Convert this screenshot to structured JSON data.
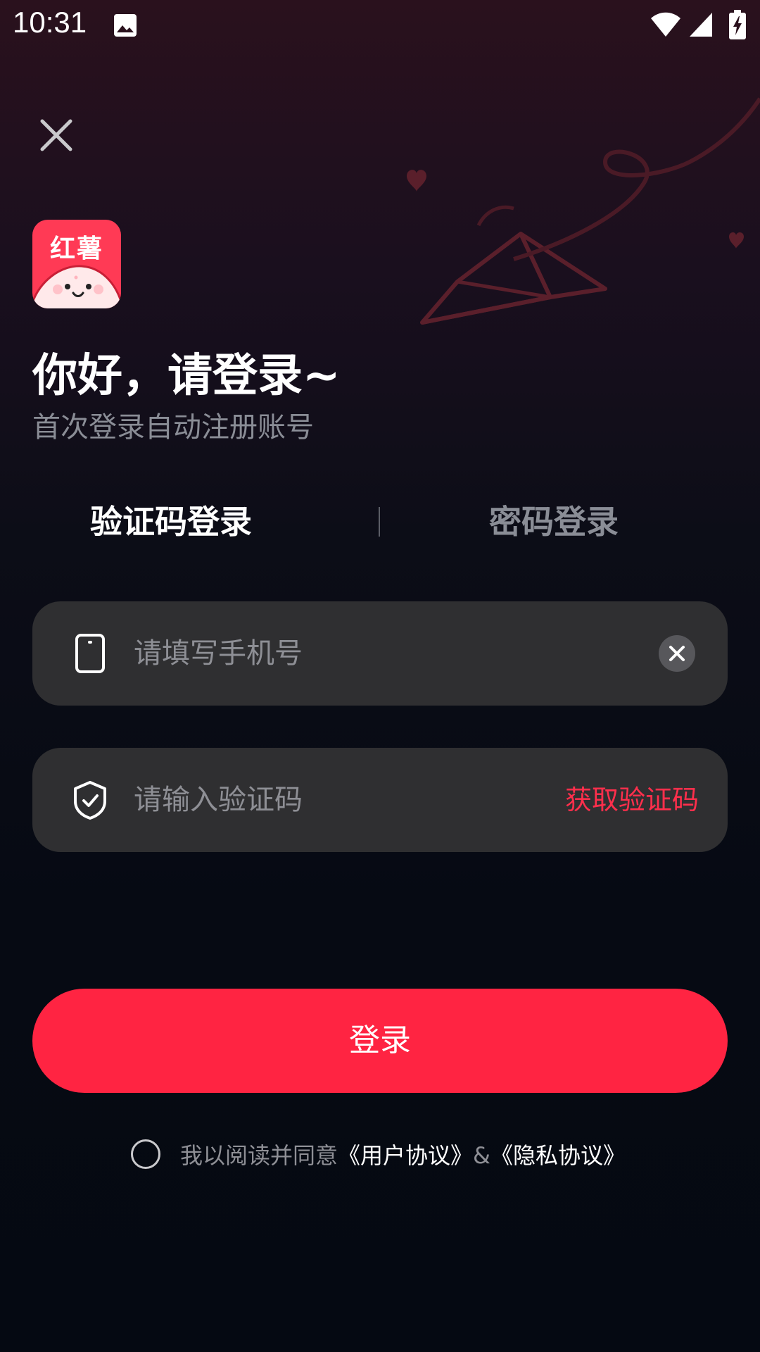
{
  "status_bar": {
    "time": "10:31"
  },
  "icons": {
    "status_image": "image-icon",
    "wifi": "wifi-icon",
    "signal": "signal-icon",
    "battery": "battery-charging-icon",
    "close": "close-icon",
    "phone": "phone-icon",
    "shield": "shield-check-icon",
    "clear": "clear-icon"
  },
  "logo": {
    "text": "红薯"
  },
  "header": {
    "greeting": "你好，请登录~",
    "subtitle": "首次登录自动注册账号"
  },
  "tabs": {
    "code_login": "验证码登录",
    "password_login": "密码登录"
  },
  "phone_field": {
    "placeholder": "请填写手机号",
    "value": ""
  },
  "code_field": {
    "placeholder": "请输入验证码",
    "value": "",
    "get_code_label": "获取验证码"
  },
  "login_button": {
    "label": "登录"
  },
  "agreement": {
    "prefix": "我以阅读并同意",
    "user_agreement": "《用户协议》",
    "separator": "&",
    "privacy_agreement": "《隐私协议》",
    "checked": false
  },
  "colors": {
    "accent": "#ff2442",
    "field_background": "#2f2f31",
    "muted_text": "#8e8f95"
  }
}
